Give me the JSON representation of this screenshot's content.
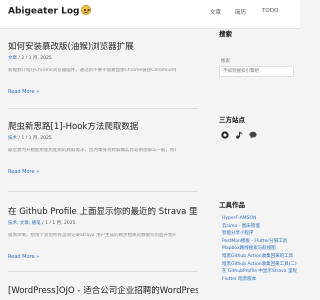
{
  "site": {
    "title": "Abigeater Log"
  },
  "nav": {
    "items": [
      "文章",
      "简历",
      "TODO"
    ]
  },
  "posts": [
    {
      "title": "如何安装慕改版(油猴)浏览器扩展",
      "category": "文章",
      "date": "2 / 1 月, 2025",
      "summary": "新视频介绍在Chrome浏览器插件，通过新不要不需要直接Chrome链接Chromium插件 Chrome下载 [...]",
      "read_more": "Read More »"
    },
    {
      "title": "爬虫新思路[1]-Hook方法爬取数据",
      "category": "技术",
      "date": "1 / 1 月, 2025",
      "summary": "最近想为开始使用使用使用的爬取需求，因为本身对爬取确实比较熟悉那么一般，所以最终下来了，因为全部使用使用使用使用 [...]",
      "read_more": "Read More »"
    },
    {
      "title": "在 Github Profile 上面显示你的最近的 Strava 里程",
      "categories": [
        "技术",
        "文章"
      ],
      "tags": [
        "随笔"
      ],
      "date": "1 / 1 月, 2025",
      "summary": "很简单啊，想用个总把所有运动记录Strava 用户生成的跑步相关的数据作页面开始内，可以以往不同，也可以把进行 [...]",
      "read_more": "Read More »"
    },
    {
      "title": "[WordPress]OJO - 适合公司企业招聘的WordPress主题"
    }
  ],
  "sidebar": {
    "search_heading": "搜索",
    "search_label": "搜索",
    "search_placeholder": "不如到搜索引擎吧",
    "social_heading": "三方站点",
    "social_icons": [
      "github-icon",
      "music-icon",
      "chat-icon"
    ],
    "tools_heading": "工具作品",
    "tools": [
      "HyperF-AMSON",
      "云simo - 图床管理",
      "智能分享小程序",
      "PostMan模板 - Flutter分隔工具",
      "Mapbox路线搜索与航线图",
      "暗黑Github Action收集回来的工具",
      "暗黑Github Action收集回来工具(二)",
      "在 GithubProfile 中显示Strava 里程",
      "Flutter 暗黑版本"
    ]
  },
  "colors": {
    "link": "#2a6dbf",
    "accent": "#f4c542"
  }
}
